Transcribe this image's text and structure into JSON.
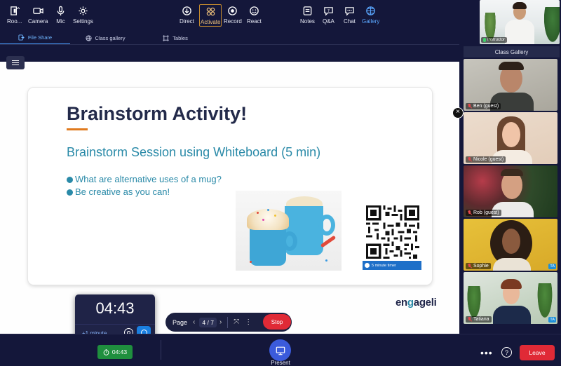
{
  "tabs": [
    {
      "label": "File Share",
      "icon": "share-icon",
      "active": true
    },
    {
      "label": "Class gallery",
      "icon": "globe-icon",
      "active": false
    },
    {
      "label": "Tables",
      "icon": "tables-icon",
      "active": false
    }
  ],
  "instructor": {
    "label": "Instructor"
  },
  "slide": {
    "title": "Brainstorm Activity!",
    "subtitle": "Brainstorm Session using Whiteboard (5 min)",
    "bullets": [
      "What are alternative uses of a mug?",
      "Be creative as you can!"
    ],
    "qr_caption": "5 minute timer",
    "logo_prefix": "en",
    "logo_accent": "g",
    "logo_suffix": "ageli"
  },
  "timer_popup": {
    "time": "04:43",
    "add_label": "+1 minute"
  },
  "page_control": {
    "label": "Page",
    "current": "4",
    "total": "/ 7",
    "stop_label": "Stop"
  },
  "gallery": {
    "header": "Class Gallery",
    "participants": [
      {
        "name": "Ben (guest)",
        "ta": false
      },
      {
        "name": "Nicole (guest)",
        "ta": false
      },
      {
        "name": "Rob (guest)",
        "ta": false
      },
      {
        "name": "Sophie",
        "ta": true,
        "ta_label": "TA"
      },
      {
        "name": "Tatiana",
        "ta": true,
        "ta_label": "TA"
      }
    ]
  },
  "toolbar": {
    "rooms": "Roo...",
    "camera": "Camera",
    "mic": "Mic",
    "settings": "Settings",
    "timer": "04:43",
    "direct": "Direct",
    "activate": "Activate",
    "record": "Record",
    "react": "React",
    "present": "Present",
    "notes": "Notes",
    "qa": "Q&A",
    "chat": "Chat",
    "gallery": "Gallery",
    "leave": "Leave"
  },
  "colors": {
    "background": "#14173a",
    "accent_blue": "#4a9eff",
    "stop_red": "#e02a36",
    "timer_green": "#1f8f3e",
    "title_navy": "#232a4a",
    "slide_teal": "#2a8aa8",
    "underline_orange": "#e07a1e"
  }
}
